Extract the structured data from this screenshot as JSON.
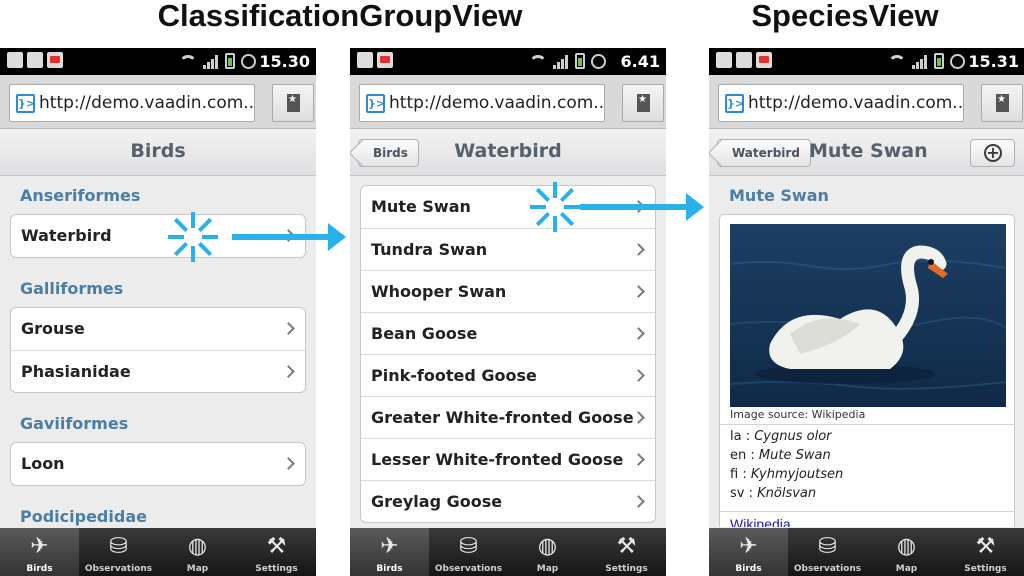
{
  "headings": {
    "left": "ClassificationGroupView",
    "right": "SpeciesView"
  },
  "browser": {
    "url": "http://demo.vaadin.com..."
  },
  "tabs": [
    {
      "label": "Birds",
      "icon": "bird-icon"
    },
    {
      "label": "Observations",
      "icon": "binoculars-icon"
    },
    {
      "label": "Map",
      "icon": "globe-icon"
    },
    {
      "label": "Settings",
      "icon": "tools-icon"
    }
  ],
  "screen1": {
    "time": "15.30",
    "title": "Birds",
    "sections": [
      {
        "title": "Anseriformes",
        "items": [
          "Waterbird"
        ]
      },
      {
        "title": "Galliformes",
        "items": [
          "Grouse",
          "Phasianidae"
        ]
      },
      {
        "title": "Gaviiformes",
        "items": [
          "Loon"
        ]
      },
      {
        "title": "Podicipedidae",
        "items": []
      }
    ]
  },
  "screen2": {
    "time": "6.41",
    "back": "Birds",
    "title": "Waterbird",
    "items": [
      "Mute Swan",
      "Tundra Swan",
      "Whooper Swan",
      "Bean Goose",
      "Pink-footed Goose",
      "Greater White-fronted Goose",
      "Lesser White-fronted Goose",
      "Greylag Goose"
    ]
  },
  "screen3": {
    "time": "15.31",
    "back": "Waterbird",
    "title": "Mute Swan",
    "section": "Mute Swan",
    "caption": "Image source: Wikipedia",
    "names": [
      {
        "lang": "la",
        "name": "Cygnus olor"
      },
      {
        "lang": "en",
        "name": "Mute Swan"
      },
      {
        "lang": "fi",
        "name": "Kyhmyjoutsen"
      },
      {
        "lang": "sv",
        "name": "Knölsvan"
      }
    ],
    "link": "Wikipedia"
  },
  "colors": {
    "accent_arrow": "#2ab0ea",
    "section_title": "#4a7ea6",
    "link": "#1a1ab8"
  }
}
